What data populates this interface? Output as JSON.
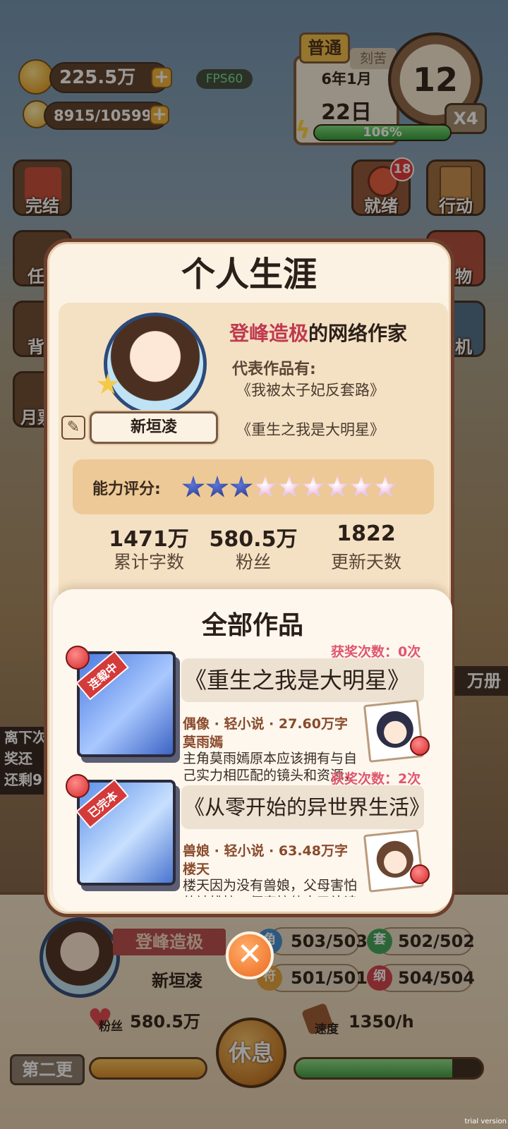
{
  "hud": {
    "coins": "225.5万",
    "energy": "8915/10599",
    "fps": "FPS60",
    "difficulty": "普通",
    "tag_behind": "刻苦",
    "date_line1": "6年1月",
    "date_line2": "22日",
    "hour": "12",
    "speed": "X4",
    "progress": "106%",
    "progress_value": 1.0
  },
  "side_left": [
    "完结",
    "任",
    "背",
    "月票"
  ],
  "side_right": [
    {
      "label": "就绪",
      "badge": "18"
    },
    {
      "label": "行动"
    },
    {
      "label": "物"
    },
    {
      "label": "机"
    }
  ],
  "side_right_extra": "万册",
  "left_notice": [
    "离下次",
    "奖还",
    "还剩9"
  ],
  "panel": {
    "title": "个人生涯",
    "rank": "登峰造极",
    "rank_suffix": "的网络作家",
    "rep_label": "代表作品有:",
    "rep_works": [
      "《我被太子妃反套路》",
      "《重生之我是大明星》"
    ],
    "name": "新垣凌",
    "rating_label": "能力评分:",
    "rating_value": 3,
    "rating_max": 9,
    "stats": [
      {
        "value": "1471万",
        "label": "累计字数"
      },
      {
        "value": "580.5万",
        "label": "粉丝"
      },
      {
        "value": "1822",
        "label": "更新天数"
      }
    ],
    "works_title": "全部作品",
    "works": [
      {
        "status": "连载中",
        "award": "获奖次数：0次",
        "title": "《重生之我是大明星》",
        "meta": "偶像 · 轻小说 · 27.60万字",
        "heroine": "莫雨嫣",
        "desc": "主角莫雨嫣原本应该拥有与自己实力相匹配的镜头和资源，"
      },
      {
        "status": "已完本",
        "award": "获奖次数：2次",
        "title": "《从零开始的异世界生活》",
        "meta": "兽娘 · 轻小说 · 63.48万字",
        "heroine": "楼天",
        "desc": "楼天因为没有兽娘，父母害怕他被排挤，便直接他去了补读"
      }
    ]
  },
  "footer": {
    "rank": "登峰造极",
    "name": "新垣凌",
    "stat1_icon": "角",
    "stat1": "503/503",
    "stat2_icon": "套",
    "stat2": "502/502",
    "stat3_icon": "符",
    "stat3": "501/501",
    "stat4_icon": "纲",
    "stat4": "504/504",
    "fans_label": "粉丝",
    "fans": "580.5万",
    "speed_label": "速度",
    "speed": "1350/h",
    "rest": "休息",
    "chapter": "第二更"
  },
  "watermark": "trial version",
  "colors": {
    "accent": "#c0394f",
    "panel_border": "#6c3f2c",
    "close": "#f07c2a"
  }
}
